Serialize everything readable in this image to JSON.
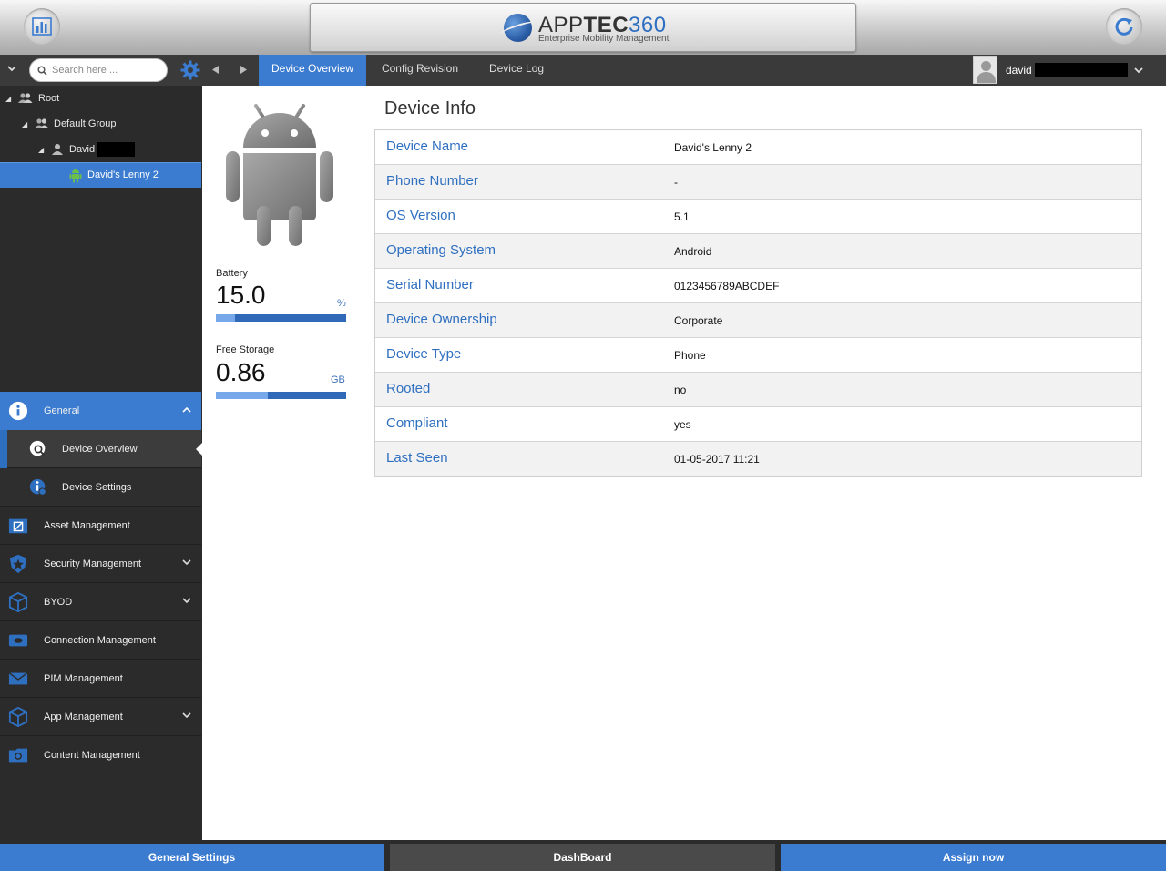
{
  "header": {
    "logo_app": "APP",
    "logo_tec": "TEC",
    "logo_num": "360",
    "logo_subtitle": "Enterprise Mobility Management"
  },
  "toolbar": {
    "search_placeholder": "Search here ...",
    "tabs": [
      "Device Overview",
      "Config Revision",
      "Device Log"
    ],
    "active_tab": "Device Overview",
    "user_name": "david"
  },
  "tree": {
    "root": "Root",
    "group": "Default Group",
    "user": "David",
    "device": "David's Lenny 2"
  },
  "menu": {
    "general": "General",
    "device_overview": "Device Overview",
    "device_settings": "Device Settings",
    "asset_management": "Asset Management",
    "security_management": "Security Management",
    "byod": "BYOD",
    "connection_management": "Connection Management",
    "pim_management": "PIM Management",
    "app_management": "App Management",
    "content_management": "Content Management"
  },
  "device_stats": {
    "battery_label": "Battery",
    "battery_value": "15.0",
    "battery_unit": "%",
    "battery_level_percent": 15,
    "storage_label": "Free Storage",
    "storage_value": "0.86",
    "storage_unit": "GB",
    "storage_fill_fraction": 0.4
  },
  "device_info": {
    "title": "Device Info",
    "rows": [
      {
        "key": "Device Name",
        "value": "David's Lenny 2"
      },
      {
        "key": "Phone Number",
        "value": "-"
      },
      {
        "key": "OS Version",
        "value": "5.1"
      },
      {
        "key": "Operating System",
        "value": "Android"
      },
      {
        "key": "Serial Number",
        "value": "0123456789ABCDEF"
      },
      {
        "key": "Device Ownership",
        "value": "Corporate"
      },
      {
        "key": "Device Type",
        "value": "Phone"
      },
      {
        "key": "Rooted",
        "value": "no"
      },
      {
        "key": "Compliant",
        "value": "yes"
      },
      {
        "key": "Last Seen",
        "value": "01-05-2017 11:21"
      }
    ]
  },
  "footer": {
    "general_settings": "General Settings",
    "dashboard": "DashBoard",
    "assign_now": "Assign now"
  },
  "colors": {
    "accent": "#3b7bd0",
    "sidebar": "#2b2b2b",
    "toolbar": "#3a3a3a",
    "label_blue": "#2f6fc0"
  }
}
